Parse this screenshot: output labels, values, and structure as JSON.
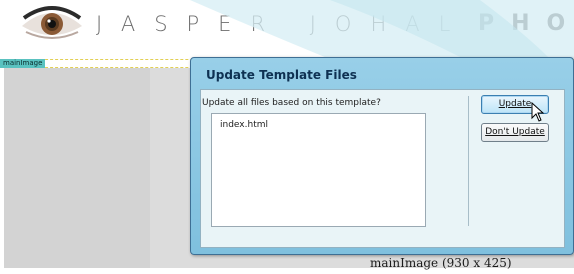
{
  "header": {
    "name_text": "JASPER JOHAL",
    "trailing_text": "PHO"
  },
  "editor": {
    "region_tag": "mainImage",
    "caption": "mainImage (930 x 425)"
  },
  "dialog": {
    "title": "Update Template Files",
    "prompt": "Update all files based on this template?",
    "files": [
      "index.html"
    ],
    "update_label": "Update",
    "dont_update_label": "Don't Update"
  },
  "colors": {
    "dialog_bg": "#8ccae3",
    "tag_bg": "#5ac2c0",
    "header_text": "#6d6d6d"
  },
  "icons": {
    "logo": "eye-icon",
    "pointer": "mouse-cursor-icon"
  }
}
